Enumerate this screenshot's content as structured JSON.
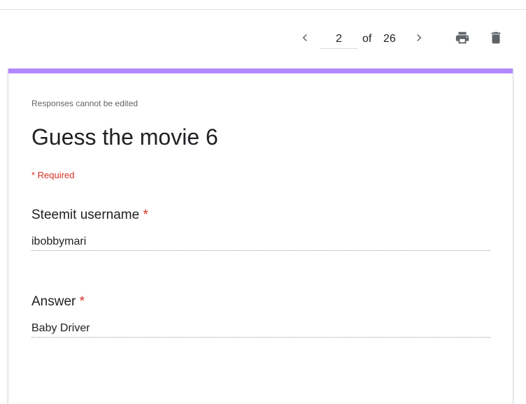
{
  "toolbar": {
    "current_page": "2",
    "of_label": "of",
    "total_pages": "26",
    "prev_icon": "chevron-left-icon",
    "next_icon": "chevron-right-icon",
    "print_icon": "print-icon",
    "delete_icon": "trash-icon"
  },
  "form": {
    "accent_color": "#b388ff",
    "notice": "Responses cannot be edited",
    "title": "Guess the movie 6",
    "required_note": "* Required",
    "questions": [
      {
        "label": "Steemit username",
        "required_mark": "*",
        "answer": "ibobbymari"
      },
      {
        "label": "Answer",
        "required_mark": "*",
        "answer": "Baby Driver"
      }
    ]
  }
}
